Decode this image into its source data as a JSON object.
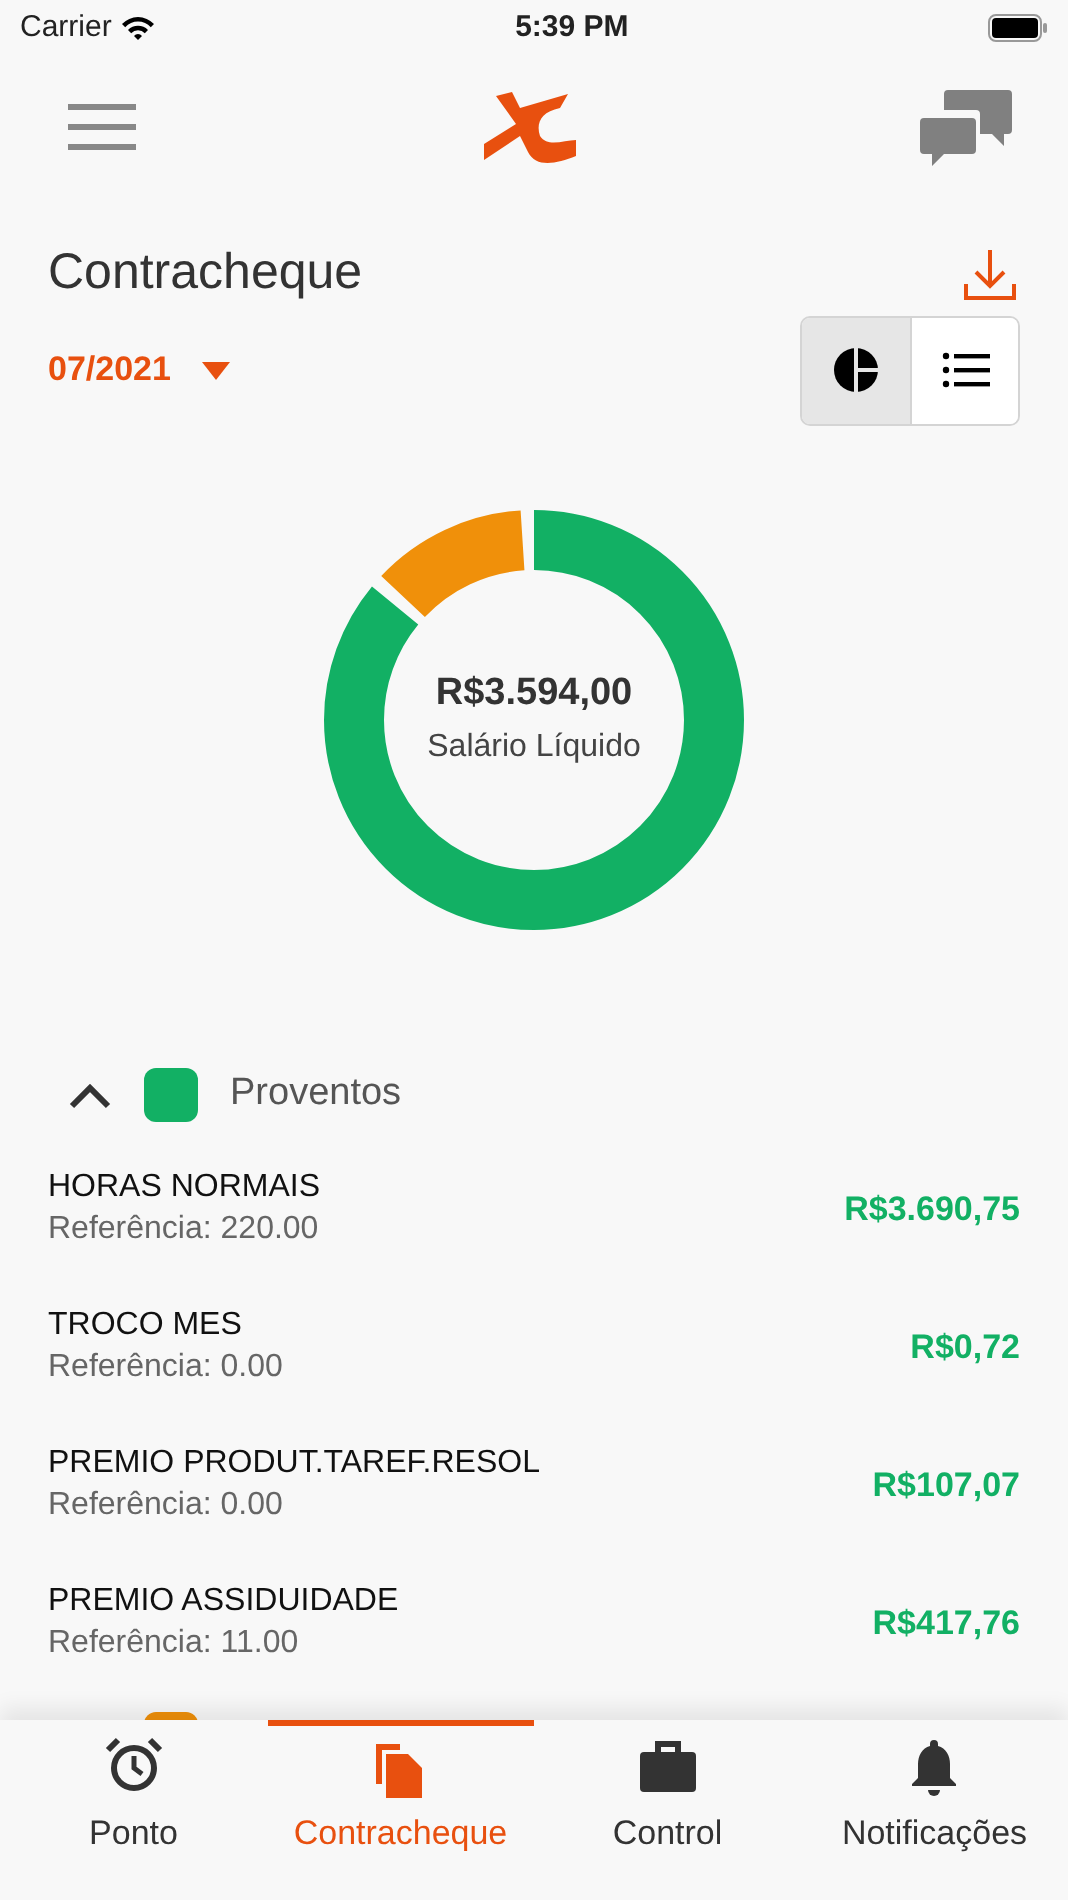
{
  "status_bar": {
    "carrier": "Carrier",
    "time": "5:39 PM"
  },
  "header": {
    "title": "Contracheque",
    "period": "07/2021"
  },
  "view_toggle": [
    {
      "kind": "chart",
      "selected": true
    },
    {
      "kind": "list",
      "selected": false
    }
  ],
  "summary": {
    "amount": "R$3.594,00",
    "label": "Salário Líquido"
  },
  "sections": [
    {
      "title": "Proventos",
      "color": "#12b064",
      "expanded": true,
      "items": [
        {
          "name": "HORAS NORMAIS",
          "reference": "Referência: 220.00",
          "amount": "R$3.690,75"
        },
        {
          "name": "TROCO MES",
          "reference": "Referência: 0.00",
          "amount": "R$0,72"
        },
        {
          "name": "PREMIO PRODUT.TAREF.RESOL",
          "reference": "Referência: 0.00",
          "amount": "R$107,07"
        },
        {
          "name": "PREMIO ASSIDUIDADE",
          "reference": "Referência: 11.00",
          "amount": "R$417,76"
        }
      ]
    },
    {
      "color": "#f0900a"
    }
  ],
  "tab_bar": [
    {
      "kind": "clock",
      "label": "Ponto",
      "selected": false
    },
    {
      "kind": "document",
      "label": "Contracheque",
      "selected": true
    },
    {
      "kind": "briefcase",
      "label": "Control",
      "selected": false
    },
    {
      "kind": "bell",
      "label": "Notificações",
      "selected": false
    }
  ]
}
